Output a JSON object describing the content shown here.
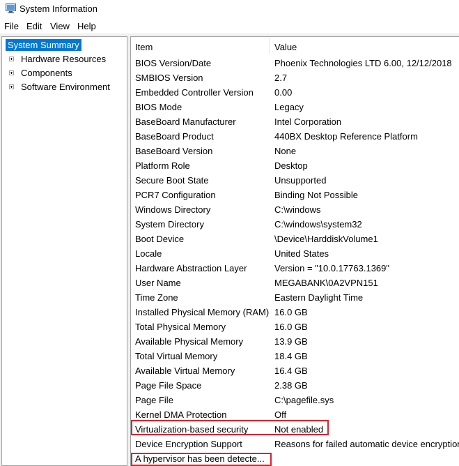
{
  "window": {
    "title": "System Information"
  },
  "menu": [
    "File",
    "Edit",
    "View",
    "Help"
  ],
  "tree": [
    {
      "label": "System Summary",
      "selected": true,
      "expandable": false
    },
    {
      "label": "Hardware Resources",
      "selected": false,
      "expandable": true
    },
    {
      "label": "Components",
      "selected": false,
      "expandable": true
    },
    {
      "label": "Software Environment",
      "selected": false,
      "expandable": true
    }
  ],
  "columns": {
    "item": "Item",
    "value": "Value"
  },
  "rows": [
    {
      "item": "BIOS Version/Date",
      "value": "Phoenix Technologies LTD 6.00, 12/12/2018"
    },
    {
      "item": "SMBIOS Version",
      "value": "2.7"
    },
    {
      "item": "Embedded Controller Version",
      "value": "0.00"
    },
    {
      "item": "BIOS Mode",
      "value": "Legacy"
    },
    {
      "item": "BaseBoard Manufacturer",
      "value": "Intel Corporation"
    },
    {
      "item": "BaseBoard Product",
      "value": "440BX Desktop Reference Platform"
    },
    {
      "item": "BaseBoard Version",
      "value": "None"
    },
    {
      "item": "Platform Role",
      "value": "Desktop"
    },
    {
      "item": "Secure Boot State",
      "value": "Unsupported"
    },
    {
      "item": "PCR7 Configuration",
      "value": "Binding Not Possible"
    },
    {
      "item": "Windows Directory",
      "value": "C:\\windows"
    },
    {
      "item": "System Directory",
      "value": "C:\\windows\\system32"
    },
    {
      "item": "Boot Device",
      "value": "\\Device\\HarddiskVolume1"
    },
    {
      "item": "Locale",
      "value": "United States"
    },
    {
      "item": "Hardware Abstraction Layer",
      "value": "Version = \"10.0.17763.1369\""
    },
    {
      "item": "User Name",
      "value": "MEGABANK\\0A2VPN151"
    },
    {
      "item": "Time Zone",
      "value": "Eastern Daylight Time"
    },
    {
      "item": "Installed Physical Memory (RAM)",
      "value": "16.0 GB"
    },
    {
      "item": "Total Physical Memory",
      "value": "16.0 GB"
    },
    {
      "item": "Available Physical Memory",
      "value": "13.9 GB"
    },
    {
      "item": "Total Virtual Memory",
      "value": "18.4 GB"
    },
    {
      "item": "Available Virtual Memory",
      "value": "16.4 GB"
    },
    {
      "item": "Page File Space",
      "value": "2.38 GB"
    },
    {
      "item": "Page File",
      "value": "C:\\pagefile.sys"
    },
    {
      "item": "Kernel DMA Protection",
      "value": "Off"
    },
    {
      "item": "Virtualization-based security",
      "value": "Not enabled"
    },
    {
      "item": "Device Encryption Support",
      "value": "Reasons for failed automatic device encryption"
    },
    {
      "item": "A hypervisor has been detecte...",
      "value": ""
    }
  ],
  "colors": {
    "selection": "#0078d7",
    "highlight_box": "#e0202a"
  },
  "icons": {
    "app": "system-information-icon",
    "expander": "plus-box-icon"
  }
}
